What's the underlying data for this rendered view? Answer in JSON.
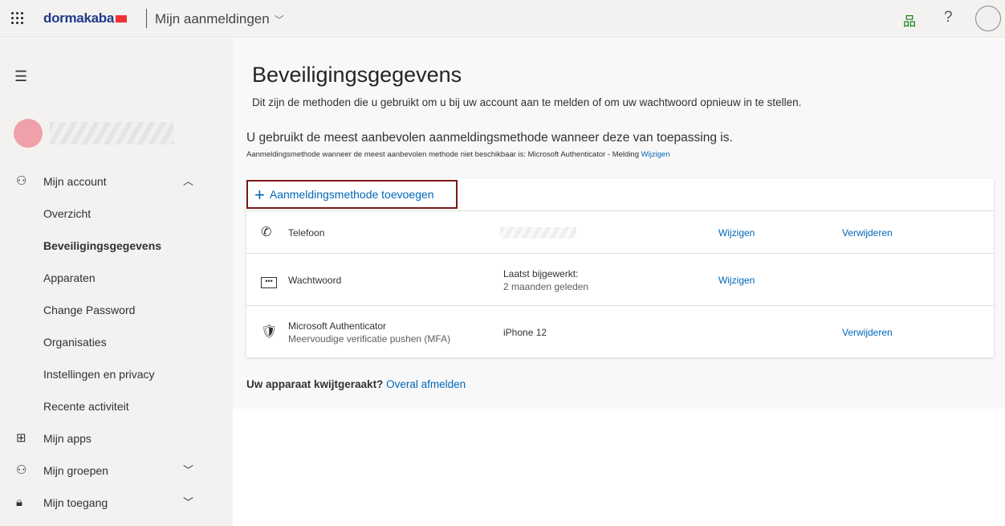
{
  "header": {
    "logo": "dormakaba",
    "app_title": "Mijn aanmeldingen"
  },
  "sidebar": {
    "items": [
      {
        "label": "Mijn account",
        "icon": "person-icon",
        "expanded": true
      },
      {
        "label": "Overzicht"
      },
      {
        "label": "Beveiligingsgegevens",
        "active": true
      },
      {
        "label": "Apparaten"
      },
      {
        "label": "Change Password"
      },
      {
        "label": "Organisaties"
      },
      {
        "label": "Instellingen en privacy"
      },
      {
        "label": "Recente activiteit"
      },
      {
        "label": "Mijn apps",
        "icon": "apps-icon"
      },
      {
        "label": "Mijn groepen",
        "icon": "groups-icon"
      },
      {
        "label": "Mijn toegang",
        "icon": "lock-icon"
      }
    ]
  },
  "main": {
    "title": "Beveiligingsgegevens",
    "description": "Dit zijn de methoden die u gebruikt om u bij uw account aan te melden of om uw wachtwoord opnieuw in te stellen.",
    "recommended": "U gebruikt de meest aanbevolen aanmeldingsmethode wanneer deze van toepassing is.",
    "fallback": "Aanmeldingsmethode wanneer de meest aanbevolen methode niet beschikbaar is: Microsoft Authenticator - Melding",
    "fallback_link": "Wijzigen",
    "add_method": "Aanmeldingsmethode toevoegen",
    "methods": [
      {
        "name": "Telefoon",
        "change": "Wijzigen",
        "remove": "Verwijderen"
      },
      {
        "name": "Wachtwoord",
        "detail1": "Laatst bijgewerkt:",
        "detail2": "2 maanden geleden",
        "change": "Wijzigen"
      },
      {
        "name": "Microsoft Authenticator",
        "sub": "Meervoudige verificatie pushen (MFA)",
        "detail1": "iPhone 12",
        "remove": "Verwijderen"
      }
    ],
    "lost_q": "Uw apparaat kwijtgeraakt?",
    "lost_link": "Overal afmelden"
  }
}
